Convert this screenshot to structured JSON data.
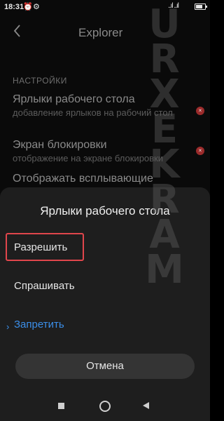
{
  "status_bar": {
    "time": "18:31",
    "alarm_icon": "⏰",
    "settings_icon": "⚙",
    "signal_text": "..ıl ..ıl"
  },
  "header": {
    "title": "Explorer"
  },
  "settings": {
    "section_label": "НАСТРОЙКИ",
    "items": [
      {
        "title": "Ярлыки рабочего стола",
        "subtitle": "добавление ярлыков на рабочий стол",
        "status_icon": "×"
      },
      {
        "title": "Экран блокировки",
        "subtitle": "отображение на экране блокировки",
        "status_icon": "×"
      },
      {
        "title": "Отображать всплывающие",
        "subtitle": ""
      }
    ]
  },
  "watermark": {
    "letters": [
      "M",
      "A",
      "R",
      "K",
      "E",
      "X",
      "R",
      "U"
    ]
  },
  "dialog": {
    "title": "Ярлыки рабочего стола",
    "options": [
      {
        "label": "Разрешить"
      },
      {
        "label": "Спрашивать"
      },
      {
        "label": "Запретить"
      }
    ],
    "selected_marker": "›",
    "cancel_label": "Отмена"
  },
  "colors": {
    "accent": "#3b8ee8",
    "highlight": "#e0464c",
    "dialog_bg": "#1e1e1e"
  }
}
